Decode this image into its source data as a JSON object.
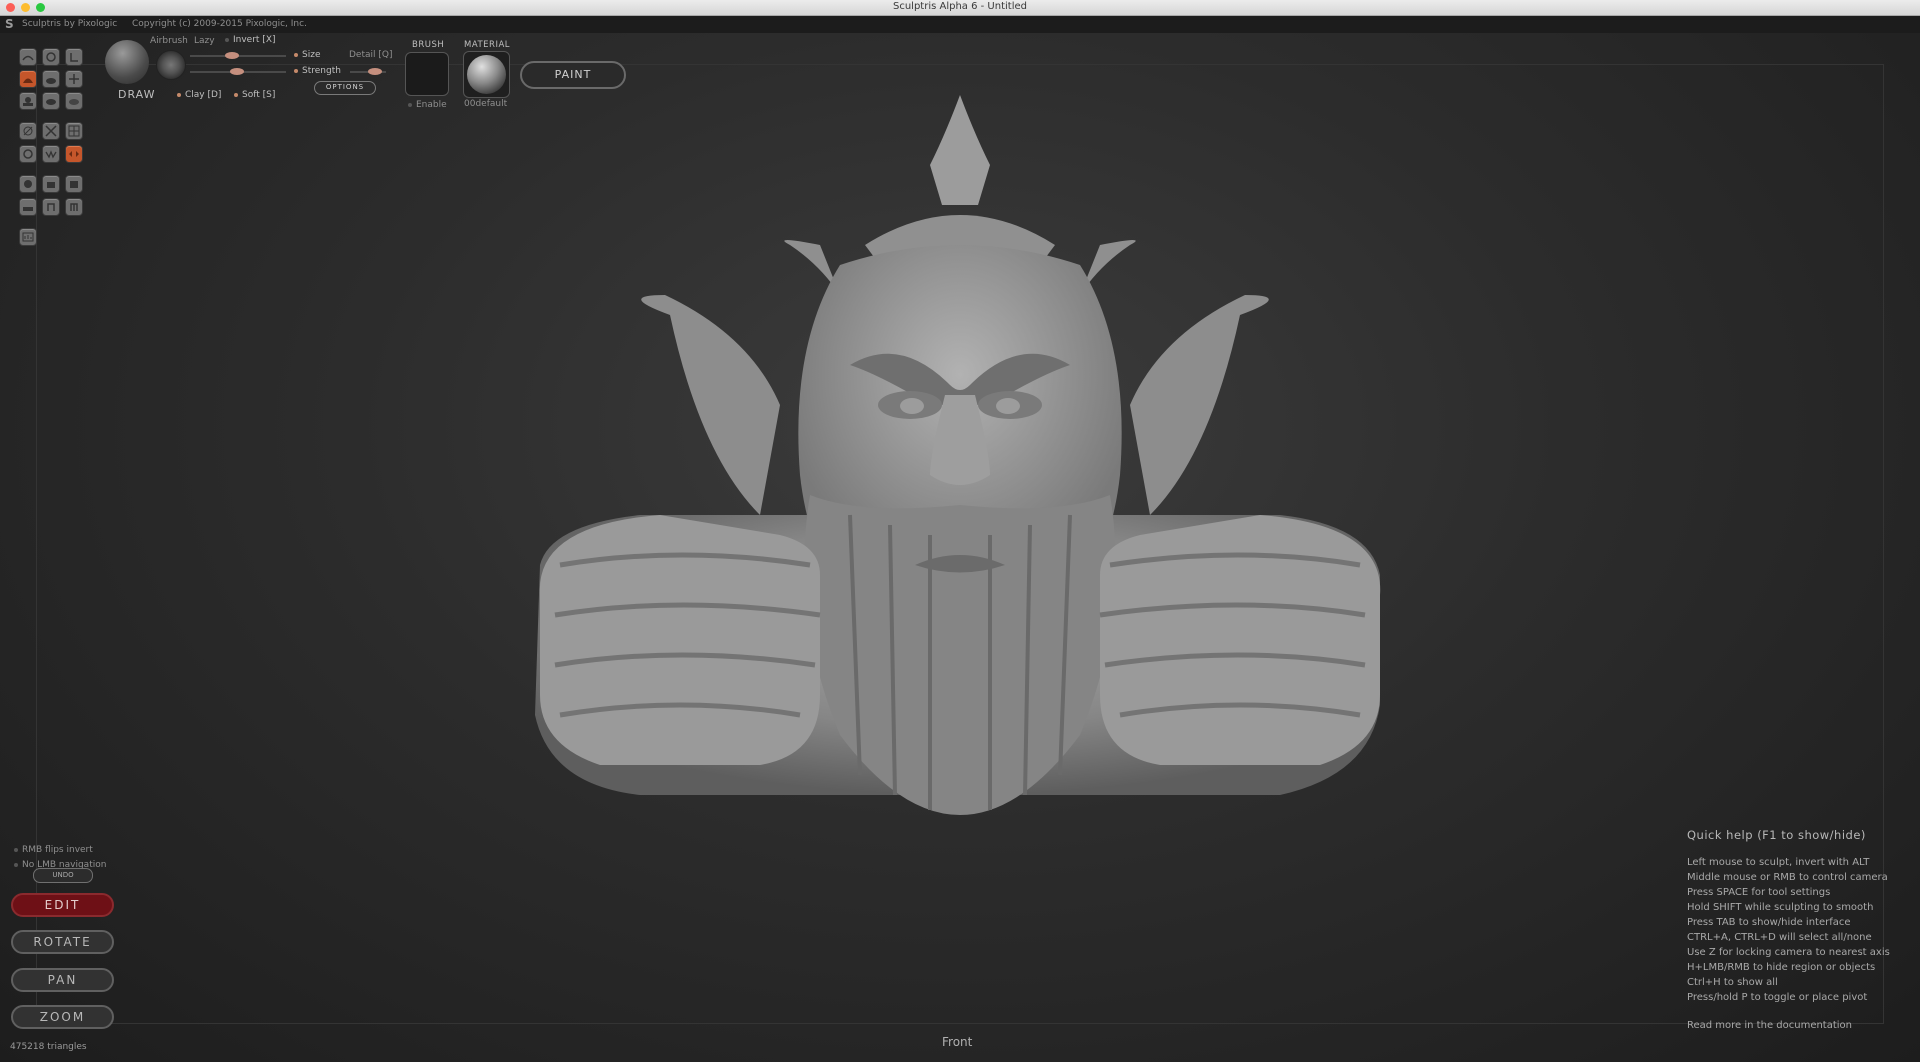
{
  "window": {
    "title": "Sculptris Alpha 6 - Untitled"
  },
  "menubar": {
    "app": "Sculptris by Pixologic",
    "copyright": "Copyright (c) 2009-2015 Pixologic, Inc."
  },
  "brush": {
    "tool_name": "DRAW",
    "airbrush": "Airbrush",
    "lazy": "Lazy",
    "invert": "Invert [X]",
    "size": "Size",
    "detail": "Detail [Q]",
    "strength": "Strength",
    "clay": "Clay [D]",
    "soft": "Soft [S]",
    "options": "OPTIONS",
    "size_level": 0.45,
    "strength_level": 0.52,
    "strength2_level": 0.6
  },
  "texture": {
    "brush_label": "BRUSH",
    "enable": "Enable",
    "material_label": "MATERIAL",
    "material_name": "00default"
  },
  "paint_button": "PAINT",
  "tips": {
    "rmb": "RMB flips invert",
    "lmb": "No LMB navigation"
  },
  "undo": "UNDO",
  "nav": {
    "edit": "EDIT",
    "rotate": "ROTATE",
    "pan": "PAN",
    "zoom": "ZOOM"
  },
  "triangles": "475218 triangles",
  "view": "Front",
  "help": {
    "title": "Quick help (F1 to show/hide)",
    "lines": [
      "Left mouse to sculpt, invert with ALT",
      "Middle mouse or RMB to control camera",
      "Press SPACE for tool settings",
      "Hold SHIFT while sculpting to smooth",
      "Press TAB to show/hide interface",
      "CTRL+A, CTRL+D will select all/none",
      "Use Z for locking camera to nearest axis",
      "H+LMB/RMB to hide region or objects",
      "Ctrl+H to show all",
      "Press/hold P to toggle or place pivot"
    ],
    "doc": "Read more in the documentation"
  },
  "colors": {
    "accent": "#c5562b",
    "edit": "#6e1016",
    "background": "#2c2c2c"
  },
  "tool_icons": [
    "crease-icon",
    "rotate-icon",
    "scale-icon",
    "draw-icon",
    "flatten-icon",
    "grab-icon",
    "inflate-icon",
    "pinch-icon",
    "smooth-icon",
    "reduce-icon",
    "mask-icon",
    "symmetry-icon",
    "wireframe-icon",
    "pick-icon",
    "mirror-icon",
    "light-icon",
    "camera-icon",
    "object-icon",
    "subdivide-icon",
    "import-icon",
    "export-icon",
    "settings-icon"
  ]
}
